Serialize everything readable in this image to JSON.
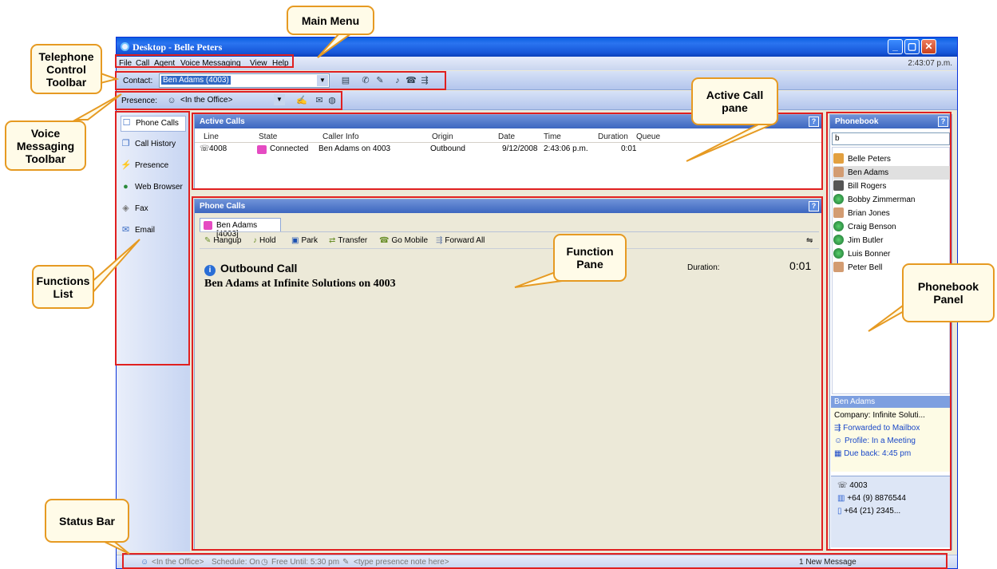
{
  "window": {
    "title": "Desktop - Belle Peters",
    "min": "_",
    "max": "▢",
    "close": "✕"
  },
  "menu": {
    "items": [
      "File",
      "Call",
      "Agent",
      "Voice Messaging",
      "View",
      "Help"
    ],
    "clock": "2:43:07 p.m."
  },
  "telephone_toolbar": {
    "label": "Contact:",
    "value": "Ben Adams (4003)"
  },
  "presence_toolbar": {
    "label": "Presence:",
    "value": "<In the Office>"
  },
  "functions": [
    "Phone Calls",
    "Call History",
    "Presence",
    "Web Browser",
    "Fax",
    "Email"
  ],
  "active_calls": {
    "title": "Active Calls",
    "columns": [
      "Line",
      "State",
      "Caller Info",
      "Origin",
      "Date",
      "Time",
      "Duration",
      "Queue"
    ],
    "row": {
      "line": "4008",
      "state": "Connected",
      "caller": "Ben Adams on 4003",
      "origin": "Outbound",
      "date": "9/12/2008",
      "time": "2:43:06 p.m.",
      "duration": "0:01"
    }
  },
  "phone_calls": {
    "title": "Phone Calls",
    "tab": "Ben Adams [4003]",
    "actions": [
      "Hangup",
      "Hold",
      "Park",
      "Transfer",
      "Go Mobile",
      "Forward All"
    ],
    "call_title": "Outbound Call",
    "call_detail": "Ben Adams at Infinite Solutions on 4003",
    "duration_label": "Duration:",
    "duration": "0:01"
  },
  "phonebook": {
    "title": "Phonebook",
    "search": "b",
    "entries": [
      "Belle Peters",
      "Ben Adams",
      "Bill Rogers",
      "Bobby Zimmerman",
      "Brian Jones",
      "Craig Benson",
      "Jim Butler",
      "Luis Bonner",
      "Peter Bell"
    ],
    "selected": "Ben Adams",
    "company": "Company: Infinite Soluti...",
    "forward": "Forwarded to Mailbox",
    "profile": "Profile: In a Meeting",
    "due": "Due back: 4:45 pm",
    "numbers": [
      "4003",
      "+64 (9) 8876544",
      "+64 (21) 2345..."
    ]
  },
  "status": {
    "presence": "<In the Office>",
    "schedule": "Schedule: On",
    "free": "Free Until: 5:30 pm",
    "note": "<type presence note here>",
    "messages": "1 New Message"
  },
  "annotations": {
    "main_menu": "Main Menu",
    "telephone_control_toolbar": "Telephone Control Toolbar",
    "voice_messaging_toolbar": "Voice Messaging Toolbar",
    "functions_list": "Functions List",
    "active_call_pane": "Active Call pane",
    "function_pane": "Function Pane",
    "phonebook_panel": "Phonebook Panel",
    "status_bar": "Status Bar"
  },
  "colors": {
    "accent": "#e69a22",
    "highlight": "#e02020",
    "title_blue": "#1656d8"
  }
}
